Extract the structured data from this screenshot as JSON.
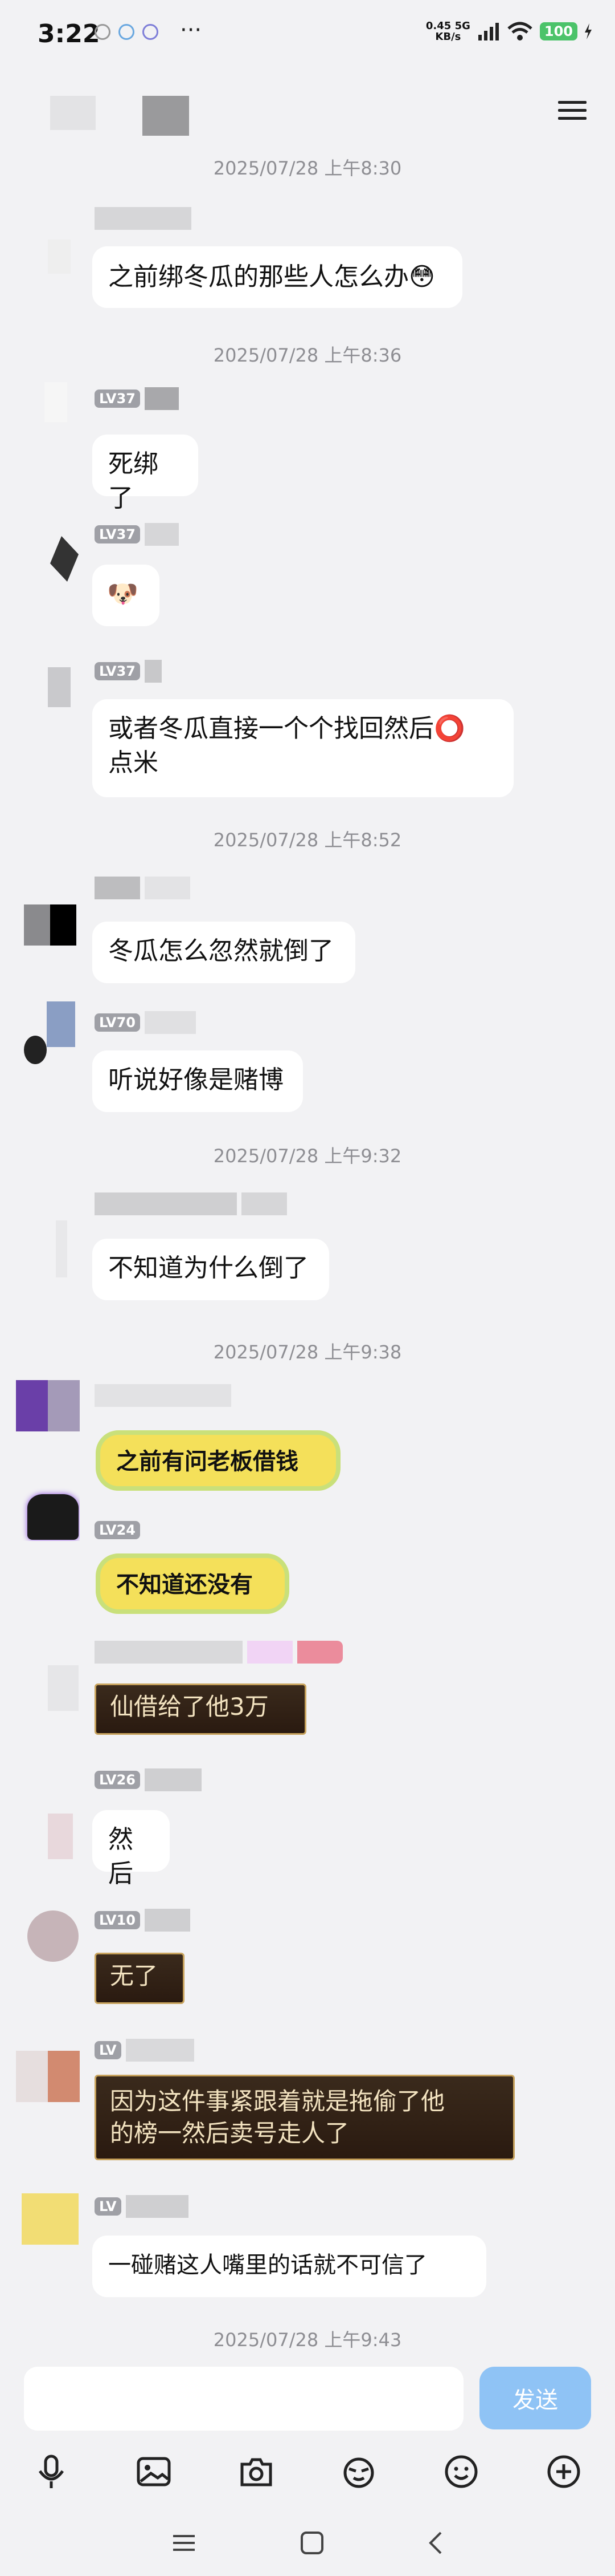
{
  "status_bar": {
    "time": "3:22",
    "dots": "···",
    "net_speed_top": "0.45 5G",
    "net_speed_bottom": "KB/s",
    "battery": "100"
  },
  "messages": {
    "ts1": "2025/07/28 上午8:30",
    "m1": "之前绑冬瓜的那些人怎么办😳",
    "ts2": "2025/07/28 上午8:36",
    "lv_m2": "LV37",
    "m2": "死绑了",
    "lv_m3": "LV37",
    "m3": "🐶",
    "lv_m4": "LV37",
    "m4_l1": "或者冬瓜直接一个个找回然后⭕",
    "m4_l2": "点米",
    "ts3": "2025/07/28 上午8:52",
    "m5": "冬瓜怎么忽然就倒了",
    "lv_m6": "LV70",
    "m6": "听说好像是赌博",
    "ts4": "2025/07/28 上午9:32",
    "m7": "不知道为什么倒了",
    "ts5": "2025/07/28 上午9:38",
    "m8": "之前有问老板借钱",
    "lv_m9": "LV24",
    "m9": "不知道还没有",
    "m10": "仙借给了他3万",
    "lv_m11": "LV26",
    "m11": "然后",
    "lv_m12": "LV10",
    "m12": "无了",
    "lv_m13": "LV",
    "m13_l1": "因为这件事紧跟着就是拖偷了他",
    "m13_l2": "的榜一然后卖号走人了",
    "lv_m14": "LV",
    "m14": "一碰赌这人嘴里的话就不可信了",
    "ts6": "2025/07/28 上午9:43"
  },
  "input": {
    "placeholder": "",
    "send_label": "发送"
  },
  "colors": {
    "send_bg": "#8fc3f5",
    "bubble_bg": "#ffffff",
    "page_bg": "#f2f2f4"
  }
}
